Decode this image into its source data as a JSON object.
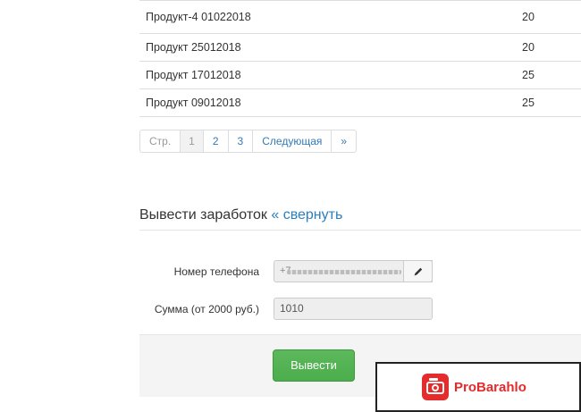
{
  "products": [
    {
      "name": "Продукт-4 01022018",
      "qty": "20"
    },
    {
      "name": "Продукт 25012018",
      "qty": "20"
    },
    {
      "name": "Продукт 17012018",
      "qty": "25"
    },
    {
      "name": "Продукт 09012018",
      "qty": "25"
    }
  ],
  "pagination": {
    "label": "Стр.",
    "pages": [
      "1",
      "2",
      "3"
    ],
    "active": "1",
    "next": "Следующая",
    "last": "»"
  },
  "withdraw": {
    "title": "Вывести заработок",
    "collapse_link": "« свернуть",
    "phone_label": "Номер телефона",
    "phone_value": "+7",
    "amount_label": "Сумма (от 2000 руб.)",
    "amount_value": "1010",
    "submit_label": "Вывести"
  },
  "watermark": {
    "brand": "ProBarahlo",
    "icon": "camera-icon"
  },
  "colors": {
    "link": "#337ab7",
    "success": "#5cb85c",
    "brand": "#e52b2b"
  }
}
